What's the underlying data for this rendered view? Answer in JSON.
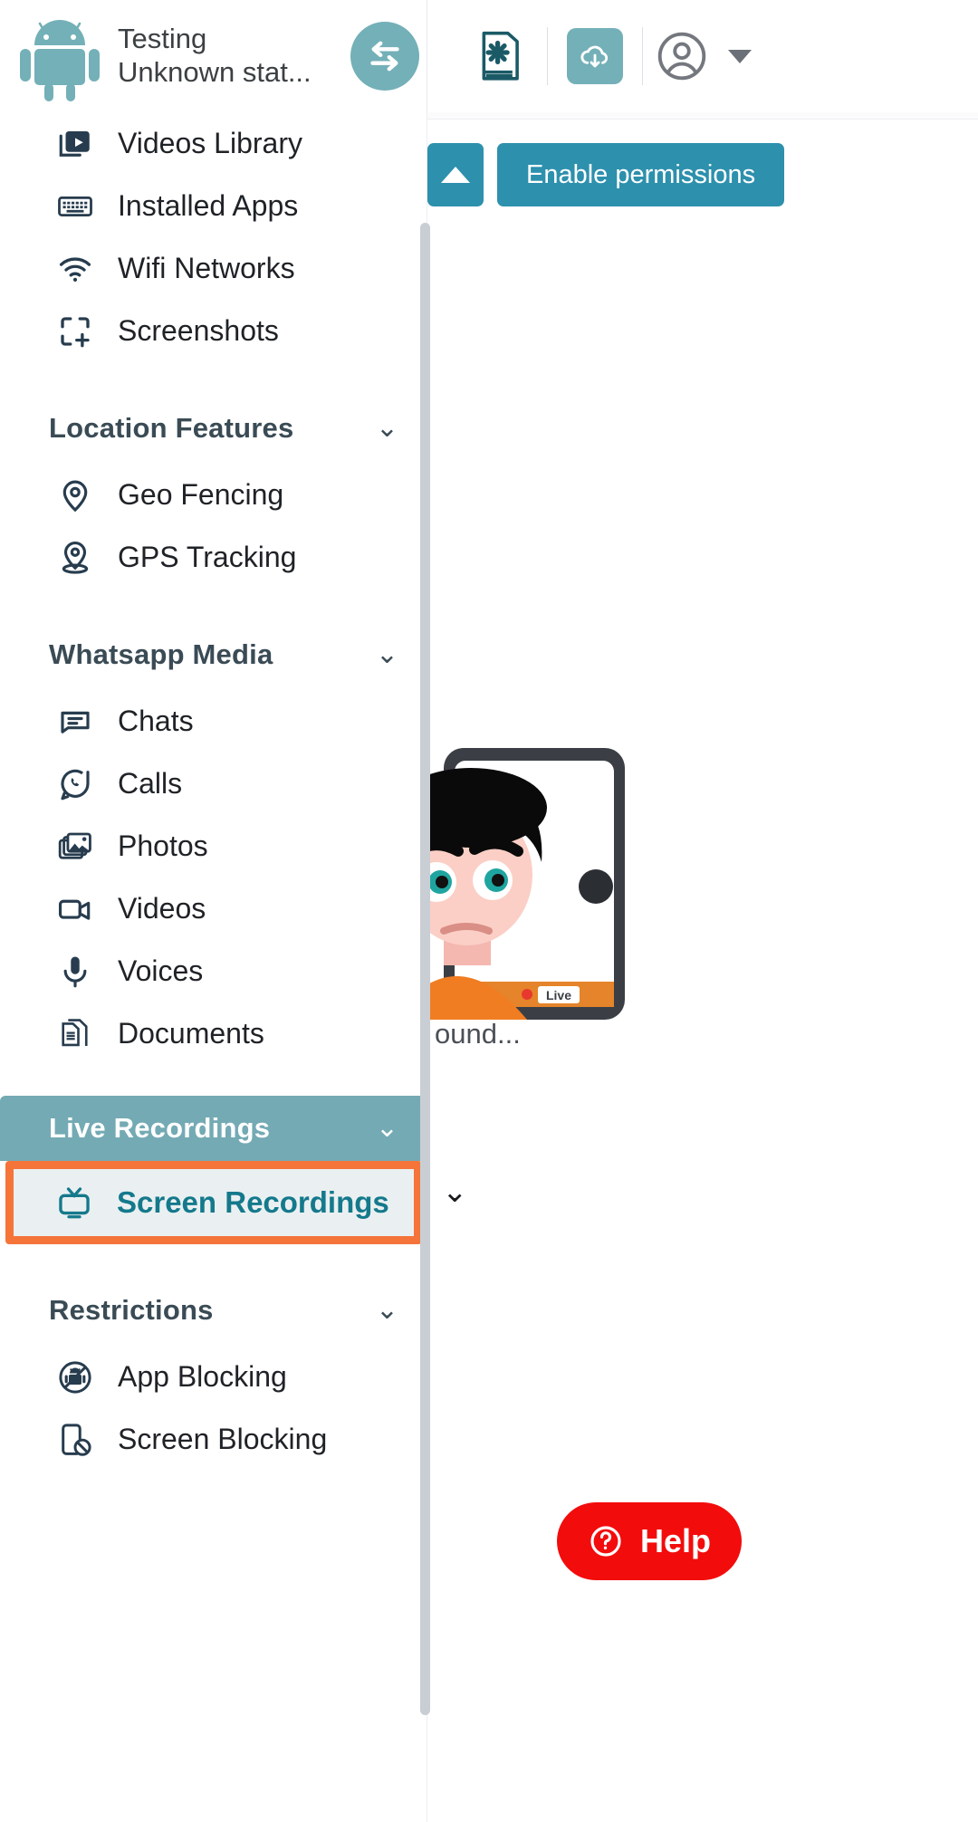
{
  "header": {
    "device_name": "Testing",
    "device_status": "Unknown stat...",
    "icons": {
      "android_logo": "android-robot-icon",
      "swap_device": "swap-arrows-icon",
      "guide_book": "book-gear-icon",
      "download_cloud": "cloud-download-icon",
      "account": "account-circle-icon",
      "account_caret": "chevron-down-icon"
    },
    "accent_color": "#74b0b8"
  },
  "content": {
    "collapse_button_icon": "triangle-up-icon",
    "enable_permissions_label": "Enable permissions",
    "caption_text": "ound...",
    "chevron_down": "⌄",
    "live_badge": "Live",
    "help_label": "Help",
    "help_icon": "question-circle-icon",
    "help_color": "#f30c0c",
    "button_color": "#2d90ad"
  },
  "sidebar": {
    "groups": [
      {
        "type": "items",
        "items": [
          {
            "label": "Videos Library",
            "icon": "video-library-icon"
          },
          {
            "label": "Installed Apps",
            "icon": "keyboard-icon"
          },
          {
            "label": "Wifi Networks",
            "icon": "wifi-icon"
          },
          {
            "label": "Screenshots",
            "icon": "screenshot-frame-icon"
          }
        ]
      },
      {
        "type": "section",
        "title": "Location Features",
        "chevron": "⌄",
        "items": [
          {
            "label": "Geo Fencing",
            "icon": "map-pin-icon"
          },
          {
            "label": "GPS Tracking",
            "icon": "gps-pin-icon"
          }
        ]
      },
      {
        "type": "section",
        "title": "Whatsapp Media",
        "chevron": "⌄",
        "items": [
          {
            "label": "Chats",
            "icon": "chat-box-icon"
          },
          {
            "label": "Calls",
            "icon": "whatsapp-call-icon"
          },
          {
            "label": "Photos",
            "icon": "photos-icon"
          },
          {
            "label": "Videos",
            "icon": "video-camera-icon"
          },
          {
            "label": "Voices",
            "icon": "microphone-icon"
          },
          {
            "label": "Documents",
            "icon": "documents-icon"
          }
        ]
      },
      {
        "type": "section-active",
        "title": "Live Recordings",
        "chevron": "⌄",
        "active_item": {
          "label": "Screen Recordings",
          "icon": "tv-icon"
        },
        "highlight_color": "#f5743a",
        "header_color": "#74aab4",
        "active_text_color": "#15798c"
      },
      {
        "type": "section",
        "title": "Restrictions",
        "chevron": "⌄",
        "items": [
          {
            "label": "App Blocking",
            "icon": "app-block-icon"
          },
          {
            "label": "Screen Blocking",
            "icon": "screen-block-icon"
          }
        ]
      }
    ]
  }
}
